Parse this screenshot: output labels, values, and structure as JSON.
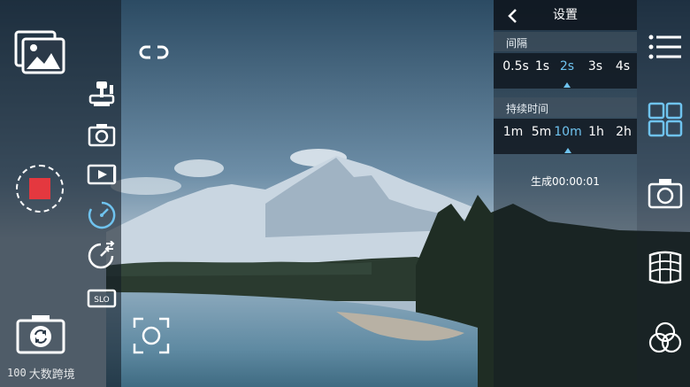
{
  "watermark": {
    "number": "100",
    "text": "大数跨境"
  },
  "settings": {
    "title": "设置",
    "interval": {
      "label": "间隔",
      "options": [
        "0.5s",
        "1s",
        "2s",
        "3s",
        "4s"
      ],
      "selected": "2s"
    },
    "duration": {
      "label": "持续时间",
      "options": [
        "1m",
        "5m",
        "10m",
        "1h",
        "2h"
      ],
      "selected": "10m"
    },
    "output_text": "生成00:00:01"
  },
  "icons": {
    "gallery": "gallery-icon",
    "gimbal": "gimbal-icon",
    "photo": "camera-icon",
    "video": "video-icon",
    "timelapse": "timelapse-icon",
    "motion_lapse": "motion-timelapse-icon",
    "slow_motion": "slow-motion-icon",
    "switch_camera": "switch-camera-icon",
    "link": "link-icon",
    "focus": "focus-icon",
    "menu": "menu-icon",
    "grid": "grid-icon",
    "camera_settings": "camera-settings-icon",
    "panorama": "panorama-icon",
    "filter": "filter-icon"
  },
  "slow_motion_label": "SLO",
  "colors": {
    "accent": "#6fc3ef",
    "record": "#e4383f"
  }
}
